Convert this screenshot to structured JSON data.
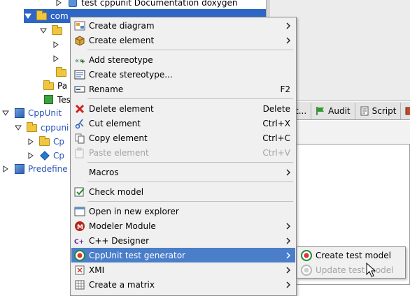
{
  "tree": {
    "rows": [
      {
        "label": "test cppunit Documentation doxygen"
      },
      {
        "label": "com"
      },
      {
        "label": "Pa"
      },
      {
        "label": "Tes"
      },
      {
        "label": "CppUnit"
      },
      {
        "label": "cppuni"
      },
      {
        "label": "Cp"
      },
      {
        "label": "Cp"
      },
      {
        "label": "Predefine"
      }
    ]
  },
  "right_panel": {
    "tabs": [
      {
        "label": "t..."
      },
      {
        "label": "Audit"
      },
      {
        "label": "Script"
      }
    ]
  },
  "context_menu": {
    "items": [
      {
        "label": "Create diagram",
        "icon": "create-diagram-icon"
      },
      {
        "label": "Create element",
        "icon": "create-element-icon"
      },
      {
        "label": "Add stereotype",
        "icon": "add-stereotype-icon"
      },
      {
        "label": "Create stereotype...",
        "icon": "create-stereotype-icon"
      },
      {
        "label": "Rename",
        "shortcut": "F2",
        "icon": "rename-icon"
      },
      {
        "label": "Delete element",
        "shortcut": "Delete",
        "icon": "delete-icon"
      },
      {
        "label": "Cut element",
        "shortcut": "Ctrl+X",
        "icon": "scissors-icon"
      },
      {
        "label": "Copy element",
        "shortcut": "Ctrl+C",
        "icon": "copy-icon"
      },
      {
        "label": "Paste element",
        "shortcut": "Ctrl+V",
        "icon": "paste-icon"
      },
      {
        "label": "Macros",
        "icon": "macros-icon"
      },
      {
        "label": "Check model",
        "icon": "check-model-icon"
      },
      {
        "label": "Open in new explorer",
        "icon": "explorer-icon"
      },
      {
        "label": "Modeler Module",
        "icon": "modeler-module-icon"
      },
      {
        "label": "C++ Designer",
        "icon": "cpp-designer-icon"
      },
      {
        "label": "CppUnit test generator",
        "icon": "cppunit-icon"
      },
      {
        "label": "XMI",
        "icon": "xmi-icon"
      },
      {
        "label": "Create a matrix",
        "icon": "matrix-icon"
      }
    ]
  },
  "submenu": {
    "items": [
      {
        "label": "Create test model"
      },
      {
        "label": "Update test model"
      }
    ]
  },
  "colors": {
    "selection": "#2f66c6",
    "menu_highlight": "#4a7ec9",
    "menu_bg": "#f0f0f0",
    "disabled_text": "#a4a4a4"
  }
}
